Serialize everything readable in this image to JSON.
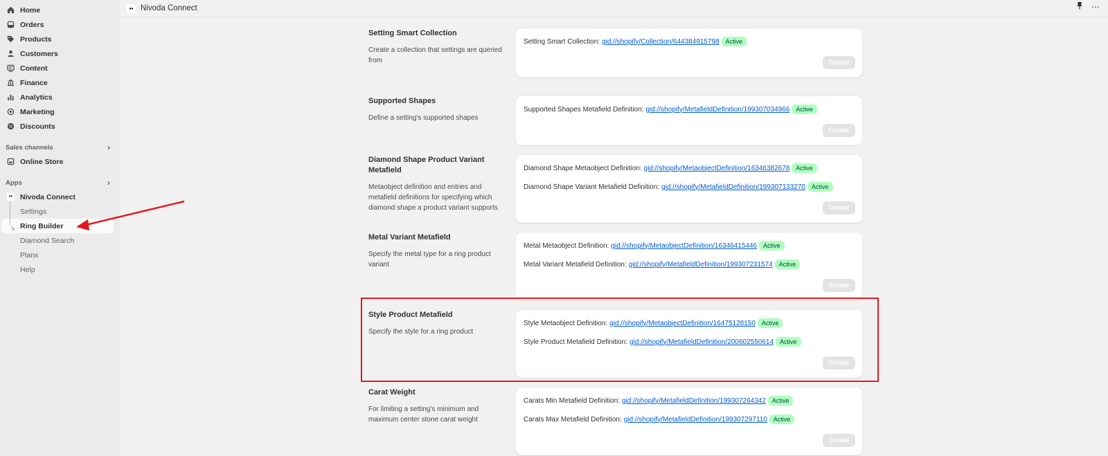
{
  "sidebar": {
    "main_items": [
      {
        "label": "Home",
        "icon": "home-icon"
      },
      {
        "label": "Orders",
        "icon": "orders-icon"
      },
      {
        "label": "Products",
        "icon": "tag-icon"
      },
      {
        "label": "Customers",
        "icon": "person-icon"
      },
      {
        "label": "Content",
        "icon": "content-icon"
      },
      {
        "label": "Finance",
        "icon": "bank-icon"
      },
      {
        "label": "Analytics",
        "icon": "bar-chart-icon"
      },
      {
        "label": "Marketing",
        "icon": "target-icon"
      },
      {
        "label": "Discounts",
        "icon": "discount-icon"
      }
    ],
    "sales_channels_label": "Sales channels",
    "online_store": "Online Store",
    "apps_label": "Apps",
    "app_name": "Nivoda Connect",
    "app_sub_items": [
      "Settings",
      "Ring Builder",
      "Diamond Search",
      "Plans",
      "Help"
    ],
    "active_sub_item": "Ring Builder"
  },
  "topbar": {
    "title": "Nivoda Connect",
    "logo_text": "••"
  },
  "sections": [
    {
      "title": "Setting Smart Collection",
      "description": "Create a collection that settings are queried from",
      "rows": [
        {
          "label": "Setting Smart Collection:",
          "link": "gid://shopify/Collection/644384915798",
          "status": "Active"
        }
      ],
      "button": "Create"
    },
    {
      "title": "Supported Shapes",
      "description": "Define a setting's supported shapes",
      "rows": [
        {
          "label": "Supported Shapes Metafield Definition:",
          "link": "gid://shopify/MetafieldDefinition/199307034966",
          "status": "Active"
        }
      ],
      "button": "Create"
    },
    {
      "title": "Diamond Shape Product Variant Metafield",
      "description": "Metaobject definition and entries and metafield definitions for specifying which diamond shape a product variant supports",
      "rows": [
        {
          "label": "Diamond Shape Metaobject Definition:",
          "link": "gid://shopify/MetaobjectDefinition/16346382678",
          "status": "Active"
        },
        {
          "label": "Diamond Shape Variant Metafield Definition:",
          "link": "gid://shopify/MetafieldDefinition/199307133270",
          "status": "Active"
        }
      ],
      "button": "Create"
    },
    {
      "title": "Metal Variant Metafield",
      "description": "Specify the metal type for a ring product variant",
      "rows": [
        {
          "label": "Metal Metaobject Definition:",
          "link": "gid://shopify/MetaobjectDefinition/16346415446",
          "status": "Active"
        },
        {
          "label": "Metal Variant Metafield Definition:",
          "link": "gid://shopify/MetafieldDefinition/199307231574",
          "status": "Active"
        }
      ],
      "button": "Create"
    },
    {
      "title": "Style Product Metafield",
      "description": "Specify the style for a ring product",
      "rows": [
        {
          "label": "Style Metaobject Definition:",
          "link": "gid://shopify/MetaobjectDefinition/16475128150",
          "status": "Active"
        },
        {
          "label": "Style Product Metafield Definition:",
          "link": "gid://shopify/MetafieldDefinition/200602550614",
          "status": "Active"
        }
      ],
      "button": "Create"
    },
    {
      "title": "Carat Weight",
      "description": "For limiting a setting's minimum and maximum center stone carat weight",
      "rows": [
        {
          "label": "Carats Min Metafield Definition:",
          "link": "gid://shopify/MetafieldDefinition/199307264342",
          "status": "Active"
        },
        {
          "label": "Carats Max Metafield Definition:",
          "link": "gid://shopify/MetafieldDefinition/199307297110",
          "status": "Active"
        }
      ],
      "button": "Create"
    }
  ],
  "colors": {
    "accent_link": "#005bd3",
    "badge_bg": "#affebf",
    "annotation_red": "#e3191e"
  }
}
